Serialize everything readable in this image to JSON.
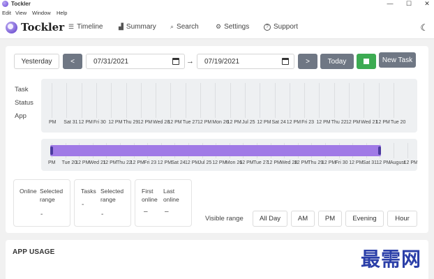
{
  "window": {
    "title": "Tockler",
    "controls": [
      "—",
      "☐",
      "✕"
    ]
  },
  "menu": [
    "Edit",
    "View",
    "Window",
    "Help"
  ],
  "nav": {
    "logo": "Tockler",
    "items": [
      {
        "label": "Timeline",
        "icon": "list-icon",
        "glyph": "☰"
      },
      {
        "label": "Summary",
        "icon": "bar-chart-icon",
        "glyph": "▟"
      },
      {
        "label": "Search",
        "icon": "search-icon",
        "glyph": "⌕"
      },
      {
        "label": "Settings",
        "icon": "gear-icon",
        "glyph": "⚙"
      },
      {
        "label": "Support",
        "icon": "help-icon",
        "glyph": "?"
      }
    ],
    "theme_icon": "moon-icon"
  },
  "toolbar": {
    "yesterday": "Yesterday",
    "prev": "<",
    "date_from": "07/31/2021",
    "range_arrow": "→",
    "date_to": "07/19/2021",
    "next": ">",
    "today": "Today",
    "new_task": "New Task"
  },
  "timeline": {
    "row_labels": [
      "Task",
      "Status",
      "App"
    ],
    "ticks": [
      "PM",
      "Sat 31",
      "12 PM",
      "Fri 30",
      "12 PM",
      "Thu 29",
      "12 PM",
      "Wed 28",
      "12 PM",
      "Tue 27",
      "12 PM",
      "Mon 26",
      "12 PM",
      "Jul 25",
      "12 PM",
      "Sat 24",
      "12 PM",
      "Fri 23",
      "12 PM",
      "Thu 22",
      "12 PM",
      "Wed 21",
      "12 PM",
      "Tue 20"
    ]
  },
  "overview": {
    "ticks": [
      "PM",
      "Tue 20",
      "12 PM",
      "Wed 21",
      "12 PM",
      "Thu 22",
      "12 PM",
      "Fri 23",
      "12 PM",
      "Sat 24",
      "12 PM",
      "Jul 25",
      "12 PM",
      "Mon 26",
      "12 PM",
      "Tue 27",
      "12 PM",
      "Wed 28",
      "12 PM",
      "Thu 29",
      "12 PM",
      "Fri 30",
      "12 PM",
      "Sat 31",
      "12 PM",
      "August",
      "12 PM"
    ]
  },
  "stats": {
    "online_label": "Online",
    "online_selected_label": "Selected range",
    "online_value": "-",
    "tasks_label": "Tasks",
    "tasks_selected_label": "Selected range",
    "tasks_value": "-",
    "tasks_selected_value": "-",
    "first_online_label": "First online",
    "first_online_value": "–",
    "last_online_label": "Last online",
    "last_online_value": "–"
  },
  "visible_range": {
    "label": "Visible range",
    "options": [
      "All Day",
      "AM",
      "PM",
      "Evening",
      "Hour"
    ]
  },
  "app_usage": {
    "title": "APP USAGE"
  },
  "watermark": "最需网",
  "colors": {
    "accent": "#a07ae6",
    "green": "#3cab52",
    "dark_button": "#6f7784"
  }
}
